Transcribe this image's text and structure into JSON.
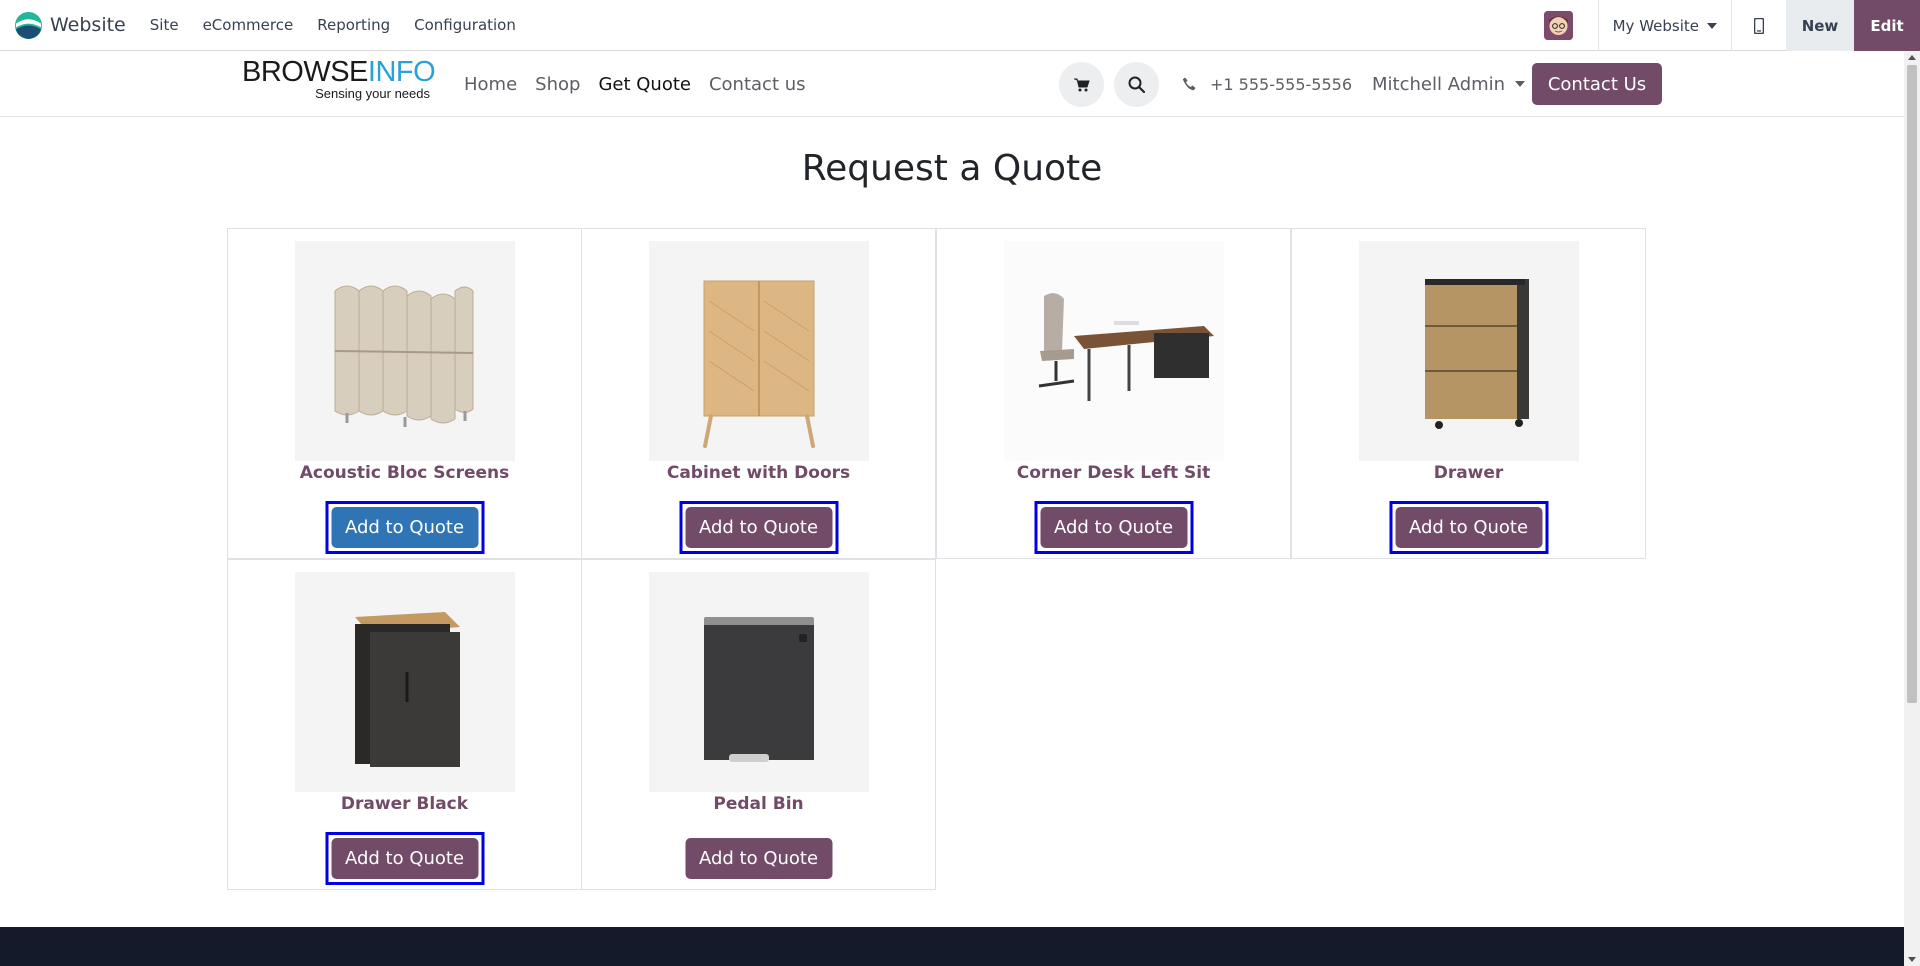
{
  "adminbar": {
    "app_name": "Website",
    "menu": [
      "Site",
      "eCommerce",
      "Reporting",
      "Configuration"
    ],
    "website_selector": "My Website",
    "new_label": "New",
    "edit_label": "Edit",
    "accent_color": "#714b67"
  },
  "header": {
    "brand_main_a": "BROWSE",
    "brand_main_b": "INFO",
    "brand_tagline": "Sensing your needs",
    "nav": [
      "Home",
      "Shop",
      "Get Quote",
      "Contact us"
    ],
    "active_nav": "Get Quote",
    "phone": "+1 555-555-5556",
    "user": "Mitchell Admin",
    "contact_button": "Contact Us"
  },
  "main": {
    "title": "Request a Quote",
    "products": [
      {
        "name": "Acoustic Bloc Screens",
        "button": "Add to Quote",
        "image": "acoustic-screen",
        "highlighted": true,
        "hover": true
      },
      {
        "name": "Cabinet with Doors",
        "button": "Add to Quote",
        "image": "cabinet",
        "highlighted": true,
        "hover": false
      },
      {
        "name": "Corner Desk Left Sit",
        "button": "Add to Quote",
        "image": "desk",
        "highlighted": true,
        "hover": false
      },
      {
        "name": "Drawer",
        "button": "Add to Quote",
        "image": "drawer",
        "highlighted": true,
        "hover": false
      },
      {
        "name": "Drawer Black",
        "button": "Add to Quote",
        "image": "drawer-black",
        "highlighted": true,
        "hover": false
      },
      {
        "name": "Pedal Bin",
        "button": "Add to Quote",
        "image": "pedal-bin",
        "highlighted": false,
        "hover": false
      }
    ]
  },
  "colors": {
    "primary": "#714b67",
    "hover_button": "#2f74b5",
    "highlight_frame": "#0000e6",
    "footer": "#131a2a"
  }
}
